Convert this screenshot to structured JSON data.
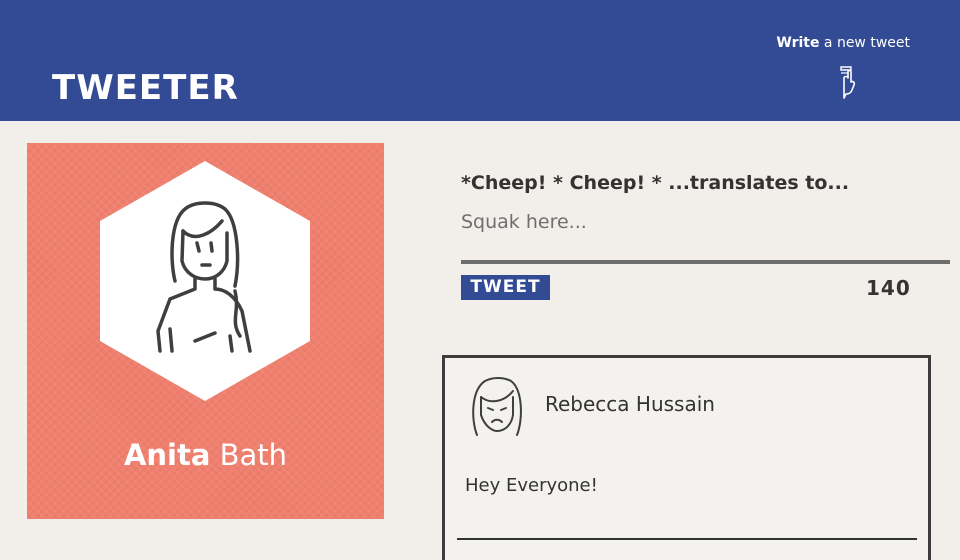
{
  "header": {
    "logo": "TWEETER",
    "compose_bold": "Write",
    "compose_rest": " a new tweet",
    "compose_icon": "pointing-down-hand-icon"
  },
  "profile": {
    "first_name": "Anita",
    "last_name": "Bath",
    "avatar_icon": "woman-avatar-icon",
    "bg_color": "#f07f6e"
  },
  "compose": {
    "label": "*Cheep! * Cheep! * ...translates to...",
    "placeholder": "Squak here...",
    "button_label": "TWEET",
    "counter": "140"
  },
  "tweets": [
    {
      "author": "Rebecca Hussain",
      "avatar_icon": "sad-woman-avatar-icon",
      "text": "Hey Everyone!"
    }
  ],
  "colors": {
    "header": "#334b95",
    "background": "#f2eee9",
    "accent": "#f07f6e"
  }
}
